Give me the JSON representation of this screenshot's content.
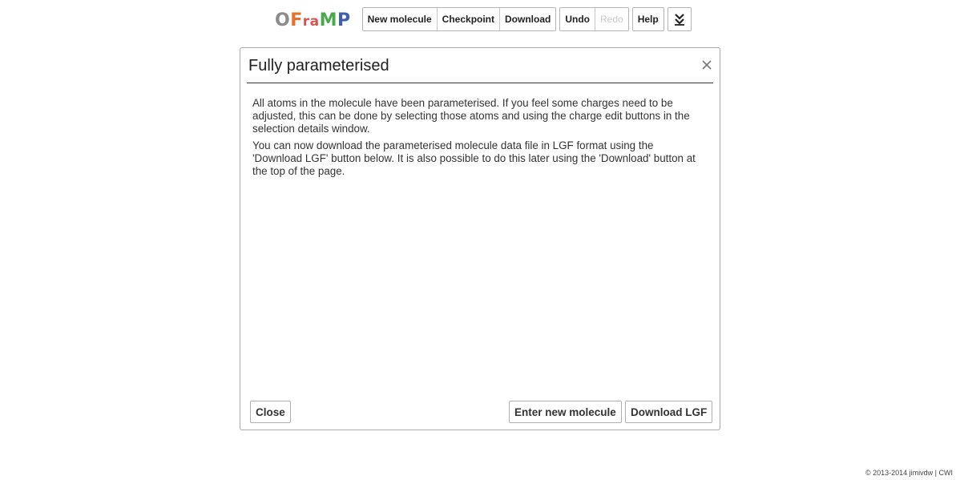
{
  "logo": {
    "letters": [
      "O",
      "F",
      "r",
      "a",
      "M",
      "P"
    ]
  },
  "toolbar": {
    "new_molecule": "New molecule",
    "checkpoint": "Checkpoint",
    "download": "Download",
    "undo": "Undo",
    "redo": "Redo",
    "help": "Help",
    "expand_icon": "double-chevron-down-icon"
  },
  "dialog": {
    "title": "Fully parameterised",
    "paragraph1": "All atoms in the molecule have been parameterised. If you feel some charges need to be adjusted, this can be done by selecting those atoms and using the charge edit buttons in the selection details window.",
    "paragraph2": "You can now download the parameterised molecule data file in LGF format using the 'Download LGF' button below. It is also possible to do this later using the 'Download' button at the top of the page.",
    "close_label": "Close",
    "enter_new_label": "Enter new molecule",
    "download_lgf_label": "Download LGF"
  },
  "footer": {
    "text": "© 2013-2014 jimivdw | CWI"
  },
  "colors": {
    "logo_o": "#8c8c8c",
    "logo_f": "#e86f2a",
    "logo_ra": "#d9534f",
    "logo_m": "#4aa84a",
    "logo_p": "#3d5fb0",
    "disabled_text": "#c9c9c9"
  }
}
